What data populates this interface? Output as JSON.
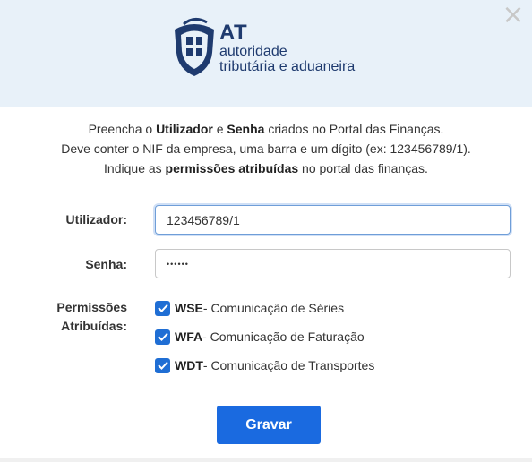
{
  "header": {
    "logo": {
      "abbr": "AT",
      "line1": "autoridade",
      "line2": "tributária e aduaneira",
      "color": "#1f3b6f"
    },
    "close_icon": "close-icon",
    "close_glyph": "×"
  },
  "intro": {
    "line1_a": "Preencha o ",
    "line1_b": "Utilizador",
    "line1_c": " e ",
    "line1_d": "Senha",
    "line1_e": " criados no Portal das Finanças.",
    "line2": "Deve conter o NIF da empresa, uma barra e um dígito (ex: 123456789/1).",
    "line3_a": "Indique as ",
    "line3_b": "permissões atribuídas",
    "line3_c": " no portal das finanças."
  },
  "form": {
    "user_label": "Utilizador:",
    "user_value": "123456789/1",
    "password_label": "Senha:",
    "password_value": "••••••",
    "permissions_label_1": "Permissões",
    "permissions_label_2": "Atribuídas:",
    "permissions": [
      {
        "code": "WSE",
        "description": " - Comunicação de Séries",
        "checked": true
      },
      {
        "code": "WFA",
        "description": " - Comunicação de Faturação",
        "checked": true
      },
      {
        "code": "WDT",
        "description": " - Comunicação de Transportes",
        "checked": true
      }
    ],
    "save_label": "Gravar"
  },
  "colors": {
    "header_bg": "#e8f1f9",
    "accent": "#1a6ae0",
    "checkbox": "#1f6ed4"
  }
}
